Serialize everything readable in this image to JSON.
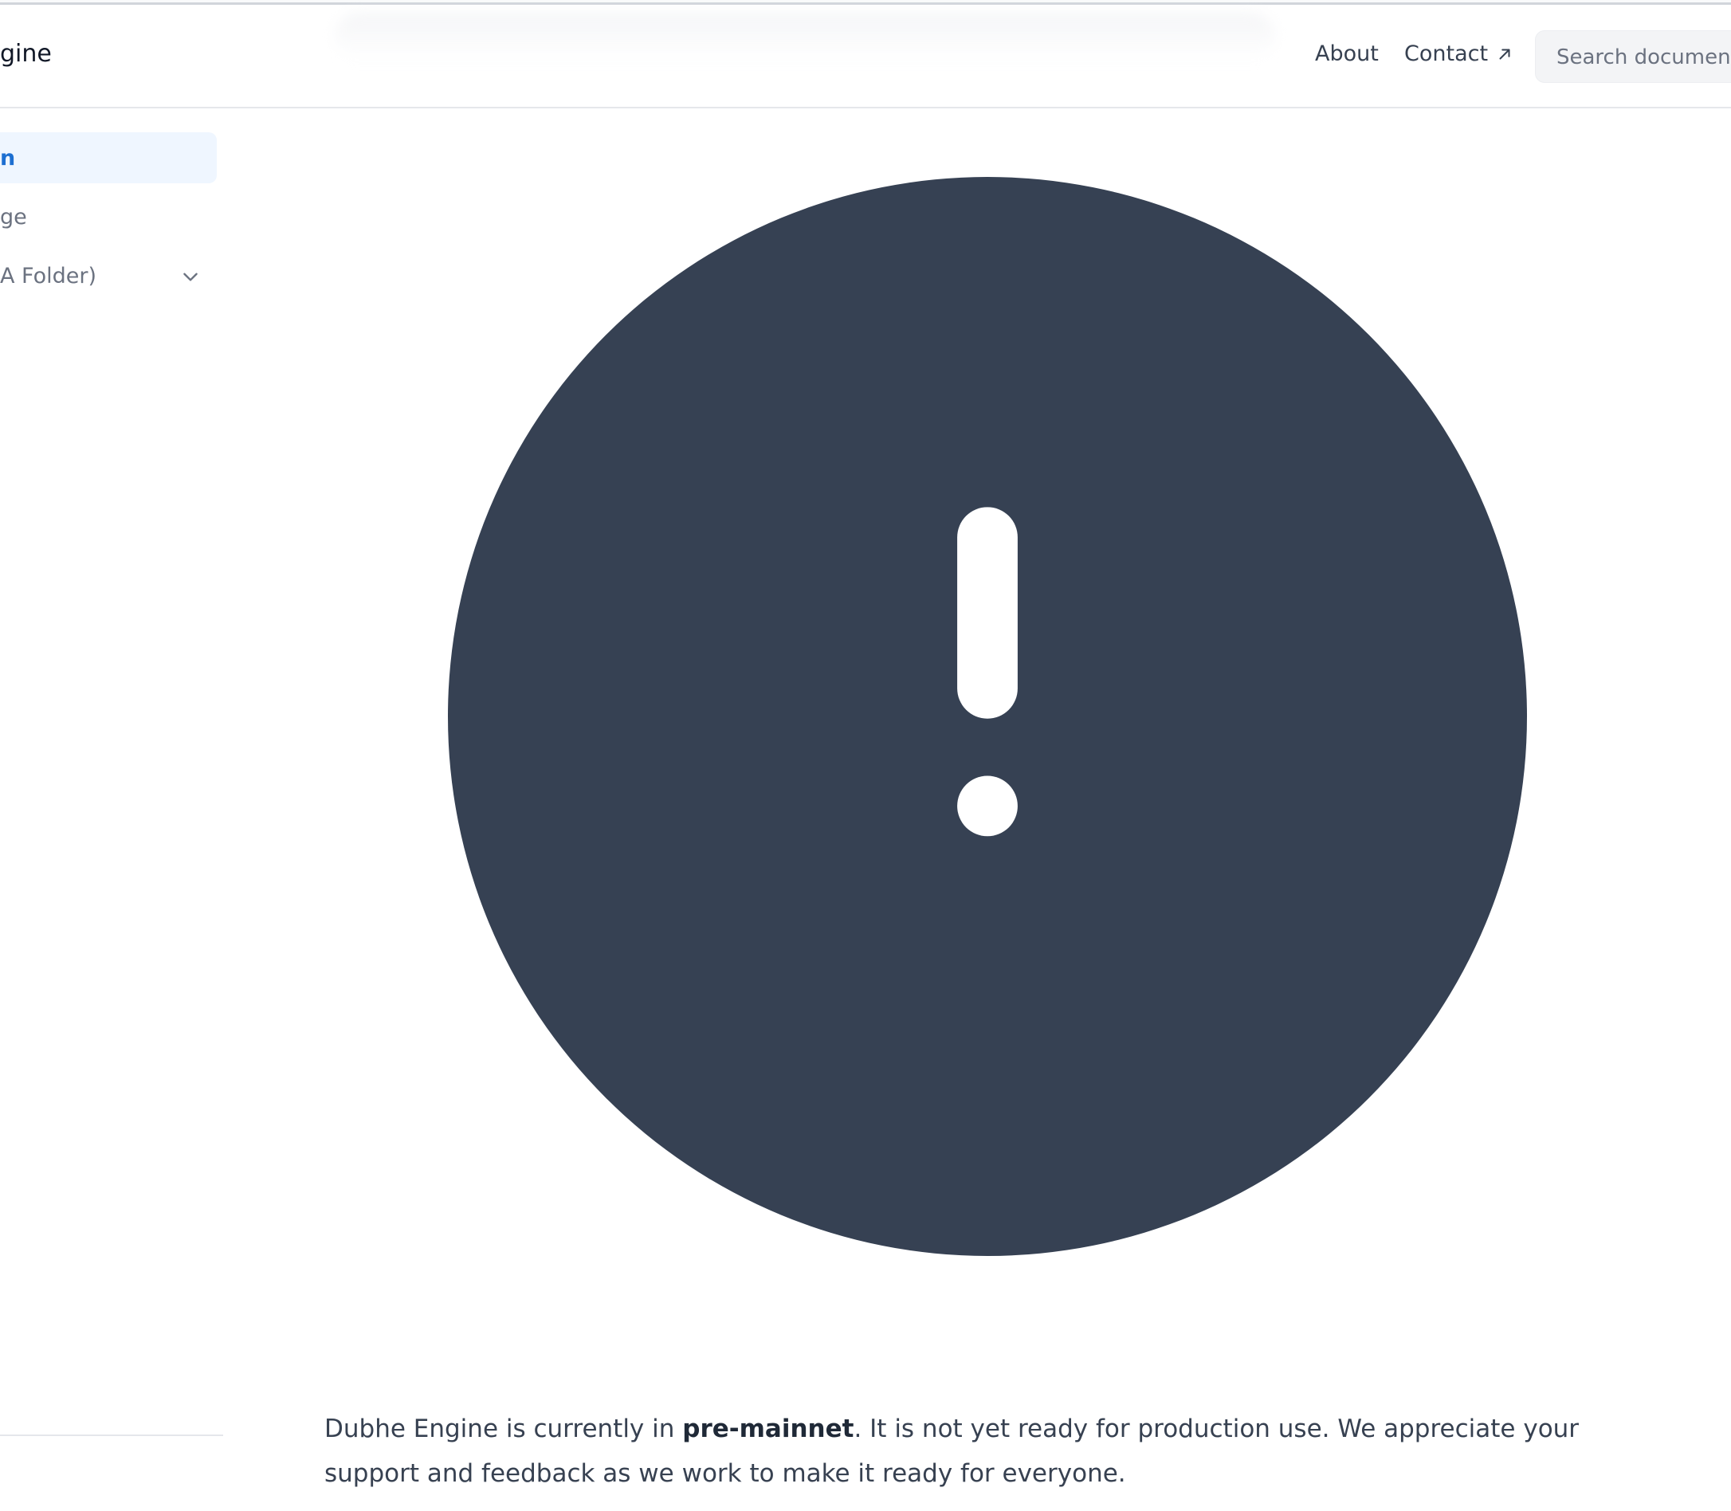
{
  "header": {
    "brand_fragment": "gine",
    "nav": {
      "about_label": "About",
      "contact_label": "Contact"
    },
    "search": {
      "placeholder": "Search documentation"
    }
  },
  "sidebar": {
    "items": [
      {
        "label": "n",
        "active": true
      },
      {
        "label": "ge",
        "active": false
      },
      {
        "label": "A Folder)",
        "active": false,
        "expandable": true
      }
    ]
  },
  "main": {
    "hero_icon": "exclamation-circle-icon",
    "notice": {
      "prefix": "Dubhe Engine is currently in ",
      "emphasis": "pre-mainnet",
      "suffix": ". It is not yet ready for production use. We appreciate your support and feedback as we work to make it ready for everyone."
    }
  },
  "colors": {
    "accent": "#1d6fd1",
    "icon_fill": "#364153",
    "text": "#374151",
    "active_bg": "#eff6ff"
  }
}
